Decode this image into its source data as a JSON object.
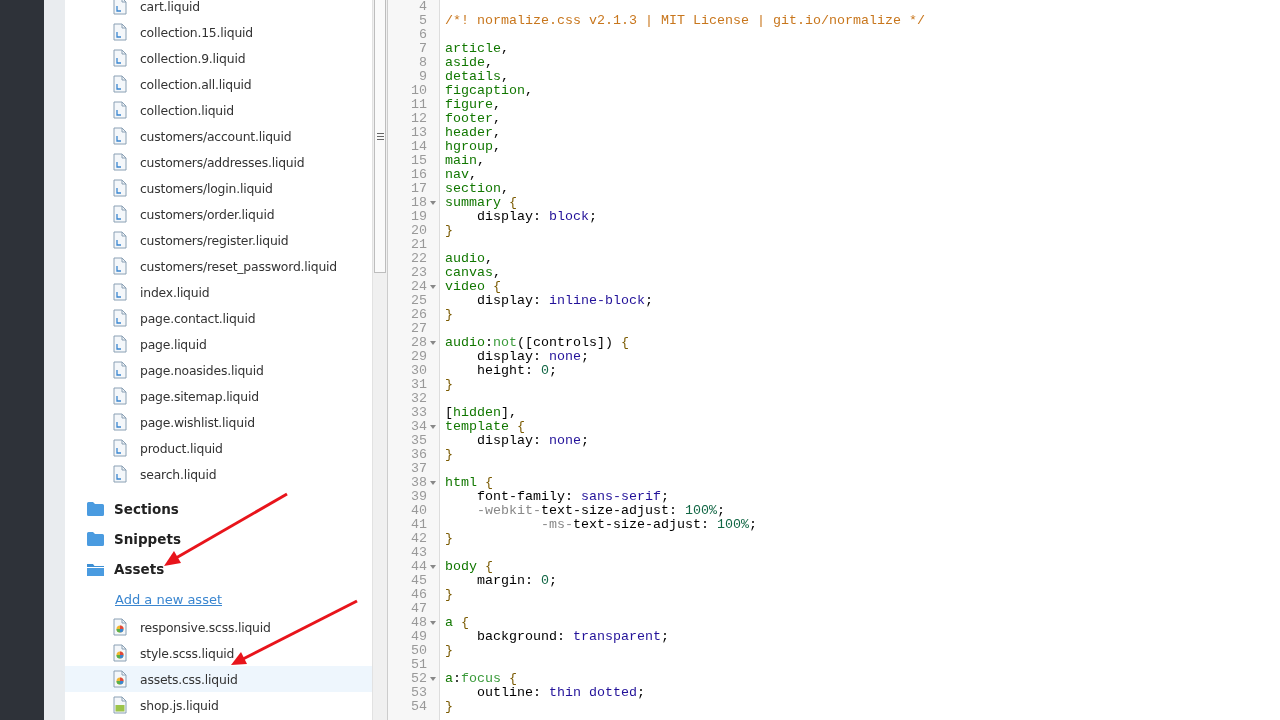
{
  "sidebar": {
    "templates": [
      {
        "name": "cart.liquid",
        "kind": "liquid"
      },
      {
        "name": "collection.15.liquid",
        "kind": "liquid"
      },
      {
        "name": "collection.9.liquid",
        "kind": "liquid"
      },
      {
        "name": "collection.all.liquid",
        "kind": "liquid"
      },
      {
        "name": "collection.liquid",
        "kind": "liquid"
      },
      {
        "name": "customers/account.liquid",
        "kind": "liquid"
      },
      {
        "name": "customers/addresses.liquid",
        "kind": "liquid"
      },
      {
        "name": "customers/login.liquid",
        "kind": "liquid"
      },
      {
        "name": "customers/order.liquid",
        "kind": "liquid"
      },
      {
        "name": "customers/register.liquid",
        "kind": "liquid"
      },
      {
        "name": "customers/reset_password.liquid",
        "kind": "liquid"
      },
      {
        "name": "index.liquid",
        "kind": "liquid"
      },
      {
        "name": "page.contact.liquid",
        "kind": "liquid"
      },
      {
        "name": "page.liquid",
        "kind": "liquid"
      },
      {
        "name": "page.noasides.liquid",
        "kind": "liquid"
      },
      {
        "name": "page.sitemap.liquid",
        "kind": "liquid"
      },
      {
        "name": "page.wishlist.liquid",
        "kind": "liquid"
      },
      {
        "name": "product.liquid",
        "kind": "liquid"
      },
      {
        "name": "search.liquid",
        "kind": "liquid"
      }
    ],
    "folders": [
      {
        "name": "Sections",
        "expanded": false
      },
      {
        "name": "Snippets",
        "expanded": false
      },
      {
        "name": "Assets",
        "expanded": true,
        "add_link": "Add a new asset",
        "files": [
          {
            "name": "responsive.scss.liquid",
            "kind": "style",
            "selected": false
          },
          {
            "name": "style.scss.liquid",
            "kind": "style",
            "selected": false
          },
          {
            "name": "assets.css.liquid",
            "kind": "style",
            "selected": true
          },
          {
            "name": "shop.js.liquid",
            "kind": "js",
            "selected": false
          }
        ]
      }
    ]
  },
  "editor": {
    "lines": [
      {
        "number": "4",
        "foldable": false
      },
      {
        "number": "5",
        "foldable": false,
        "tokens": [
          {
            "kind": "comment",
            "text": "/*! normalize.css v2.1.3 | MIT License | git.io/normalize */"
          }
        ]
      },
      {
        "number": "6",
        "foldable": false
      },
      {
        "number": "7",
        "foldable": false,
        "tokens": [
          {
            "kind": "tag",
            "text": "article"
          },
          {
            "kind": "plain",
            "text": ","
          }
        ]
      },
      {
        "number": "8",
        "foldable": false,
        "tokens": [
          {
            "kind": "tag",
            "text": "aside"
          },
          {
            "kind": "plain",
            "text": ","
          }
        ]
      },
      {
        "number": "9",
        "foldable": false,
        "tokens": [
          {
            "kind": "tag",
            "text": "details"
          },
          {
            "kind": "plain",
            "text": ","
          }
        ]
      },
      {
        "number": "10",
        "foldable": false,
        "tokens": [
          {
            "kind": "tag",
            "text": "figcaption"
          },
          {
            "kind": "plain",
            "text": ","
          }
        ]
      },
      {
        "number": "11",
        "foldable": false,
        "tokens": [
          {
            "kind": "tag",
            "text": "figure"
          },
          {
            "kind": "plain",
            "text": ","
          }
        ]
      },
      {
        "number": "12",
        "foldable": false,
        "tokens": [
          {
            "kind": "tag",
            "text": "footer"
          },
          {
            "kind": "plain",
            "text": ","
          }
        ]
      },
      {
        "number": "13",
        "foldable": false,
        "tokens": [
          {
            "kind": "tag",
            "text": "header"
          },
          {
            "kind": "plain",
            "text": ","
          }
        ]
      },
      {
        "number": "14",
        "foldable": false,
        "tokens": [
          {
            "kind": "tag",
            "text": "hgroup"
          },
          {
            "kind": "plain",
            "text": ","
          }
        ]
      },
      {
        "number": "15",
        "foldable": false,
        "tokens": [
          {
            "kind": "tag",
            "text": "main"
          },
          {
            "kind": "plain",
            "text": ","
          }
        ]
      },
      {
        "number": "16",
        "foldable": false,
        "tokens": [
          {
            "kind": "tag",
            "text": "nav"
          },
          {
            "kind": "plain",
            "text": ","
          }
        ]
      },
      {
        "number": "17",
        "foldable": false,
        "tokens": [
          {
            "kind": "tag",
            "text": "section"
          },
          {
            "kind": "plain",
            "text": ","
          }
        ]
      },
      {
        "number": "18",
        "foldable": true,
        "tokens": [
          {
            "kind": "tag",
            "text": "summary"
          },
          {
            "kind": "bracket",
            "text": " {"
          }
        ]
      },
      {
        "number": "19",
        "foldable": false,
        "tokens": [
          {
            "kind": "plain",
            "text": "    display: "
          },
          {
            "kind": "atom",
            "text": "block"
          },
          {
            "kind": "plain",
            "text": ";"
          }
        ]
      },
      {
        "number": "20",
        "foldable": false,
        "tokens": [
          {
            "kind": "bracket",
            "text": "}"
          }
        ]
      },
      {
        "number": "21",
        "foldable": false
      },
      {
        "number": "22",
        "foldable": false,
        "tokens": [
          {
            "kind": "tag",
            "text": "audio"
          },
          {
            "kind": "plain",
            "text": ","
          }
        ]
      },
      {
        "number": "23",
        "foldable": false,
        "tokens": [
          {
            "kind": "tag",
            "text": "canvas"
          },
          {
            "kind": "plain",
            "text": ","
          }
        ]
      },
      {
        "number": "24",
        "foldable": true,
        "tokens": [
          {
            "kind": "tag",
            "text": "video"
          },
          {
            "kind": "bracket",
            "text": " {"
          }
        ]
      },
      {
        "number": "25",
        "foldable": false,
        "tokens": [
          {
            "kind": "plain",
            "text": "    display: "
          },
          {
            "kind": "atom",
            "text": "inline-block"
          },
          {
            "kind": "plain",
            "text": ";"
          }
        ]
      },
      {
        "number": "26",
        "foldable": false,
        "tokens": [
          {
            "kind": "bracket",
            "text": "}"
          }
        ]
      },
      {
        "number": "27",
        "foldable": false
      },
      {
        "number": "28",
        "foldable": true,
        "tokens": [
          {
            "kind": "tag",
            "text": "audio"
          },
          {
            "kind": "plain",
            "text": ":"
          },
          {
            "kind": "pseudo",
            "text": "not"
          },
          {
            "kind": "plain",
            "text": "([controls])"
          },
          {
            "kind": "bracket",
            "text": " {"
          }
        ]
      },
      {
        "number": "29",
        "foldable": false,
        "tokens": [
          {
            "kind": "plain",
            "text": "    display: "
          },
          {
            "kind": "atom",
            "text": "none"
          },
          {
            "kind": "plain",
            "text": ";"
          }
        ]
      },
      {
        "number": "30",
        "foldable": false,
        "tokens": [
          {
            "kind": "plain",
            "text": "    height: "
          },
          {
            "kind": "number",
            "text": "0"
          },
          {
            "kind": "plain",
            "text": ";"
          }
        ]
      },
      {
        "number": "31",
        "foldable": false,
        "tokens": [
          {
            "kind": "bracket",
            "text": "}"
          }
        ]
      },
      {
        "number": "32",
        "foldable": false
      },
      {
        "number": "33",
        "foldable": false,
        "tokens": [
          {
            "kind": "plain",
            "text": "["
          },
          {
            "kind": "tag",
            "text": "hidden"
          },
          {
            "kind": "plain",
            "text": "],"
          }
        ]
      },
      {
        "number": "34",
        "foldable": true,
        "tokens": [
          {
            "kind": "tag",
            "text": "template"
          },
          {
            "kind": "bracket",
            "text": " {"
          }
        ]
      },
      {
        "number": "35",
        "foldable": false,
        "tokens": [
          {
            "kind": "plain",
            "text": "    display: "
          },
          {
            "kind": "atom",
            "text": "none"
          },
          {
            "kind": "plain",
            "text": ";"
          }
        ]
      },
      {
        "number": "36",
        "foldable": false,
        "tokens": [
          {
            "kind": "bracket",
            "text": "}"
          }
        ]
      },
      {
        "number": "37",
        "foldable": false
      },
      {
        "number": "38",
        "foldable": true,
        "tokens": [
          {
            "kind": "tag",
            "text": "html"
          },
          {
            "kind": "bracket",
            "text": " {"
          }
        ]
      },
      {
        "number": "39",
        "foldable": false,
        "tokens": [
          {
            "kind": "plain",
            "text": "    font-family: "
          },
          {
            "kind": "atom",
            "text": "sans-serif"
          },
          {
            "kind": "plain",
            "text": ";"
          }
        ]
      },
      {
        "number": "40",
        "foldable": false,
        "tokens": [
          {
            "kind": "meta",
            "text": "    -webkit-"
          },
          {
            "kind": "plain",
            "text": "text-size-adjust: "
          },
          {
            "kind": "number",
            "text": "100%"
          },
          {
            "kind": "plain",
            "text": ";"
          }
        ]
      },
      {
        "number": "41",
        "foldable": false,
        "tokens": [
          {
            "kind": "meta",
            "text": "            -ms-"
          },
          {
            "kind": "plain",
            "text": "text-size-adjust: "
          },
          {
            "kind": "number",
            "text": "100%"
          },
          {
            "kind": "plain",
            "text": ";"
          }
        ]
      },
      {
        "number": "42",
        "foldable": false,
        "tokens": [
          {
            "kind": "bracket",
            "text": "}"
          }
        ]
      },
      {
        "number": "43",
        "foldable": false
      },
      {
        "number": "44",
        "foldable": true,
        "tokens": [
          {
            "kind": "tag",
            "text": "body"
          },
          {
            "kind": "bracket",
            "text": " {"
          }
        ]
      },
      {
        "number": "45",
        "foldable": false,
        "tokens": [
          {
            "kind": "plain",
            "text": "    margin: "
          },
          {
            "kind": "number",
            "text": "0"
          },
          {
            "kind": "plain",
            "text": ";"
          }
        ]
      },
      {
        "number": "46",
        "foldable": false,
        "tokens": [
          {
            "kind": "bracket",
            "text": "}"
          }
        ]
      },
      {
        "number": "47",
        "foldable": false
      },
      {
        "number": "48",
        "foldable": true,
        "tokens": [
          {
            "kind": "tag",
            "text": "a"
          },
          {
            "kind": "bracket",
            "text": " {"
          }
        ]
      },
      {
        "number": "49",
        "foldable": false,
        "tokens": [
          {
            "kind": "plain",
            "text": "    background: "
          },
          {
            "kind": "atom",
            "text": "transparent"
          },
          {
            "kind": "plain",
            "text": ";"
          }
        ]
      },
      {
        "number": "50",
        "foldable": false,
        "tokens": [
          {
            "kind": "bracket",
            "text": "}"
          }
        ]
      },
      {
        "number": "51",
        "foldable": false
      },
      {
        "number": "52",
        "foldable": true,
        "tokens": [
          {
            "kind": "tag",
            "text": "a"
          },
          {
            "kind": "plain",
            "text": ":"
          },
          {
            "kind": "pseudo",
            "text": "focus"
          },
          {
            "kind": "bracket",
            "text": " {"
          }
        ]
      },
      {
        "number": "53",
        "foldable": false,
        "tokens": [
          {
            "kind": "plain",
            "text": "    outline: "
          },
          {
            "kind": "atom",
            "text": "thin dotted"
          },
          {
            "kind": "plain",
            "text": ";"
          }
        ]
      },
      {
        "number": "54",
        "foldable": false,
        "tokens": [
          {
            "kind": "bracket",
            "text": "}"
          }
        ]
      }
    ]
  }
}
